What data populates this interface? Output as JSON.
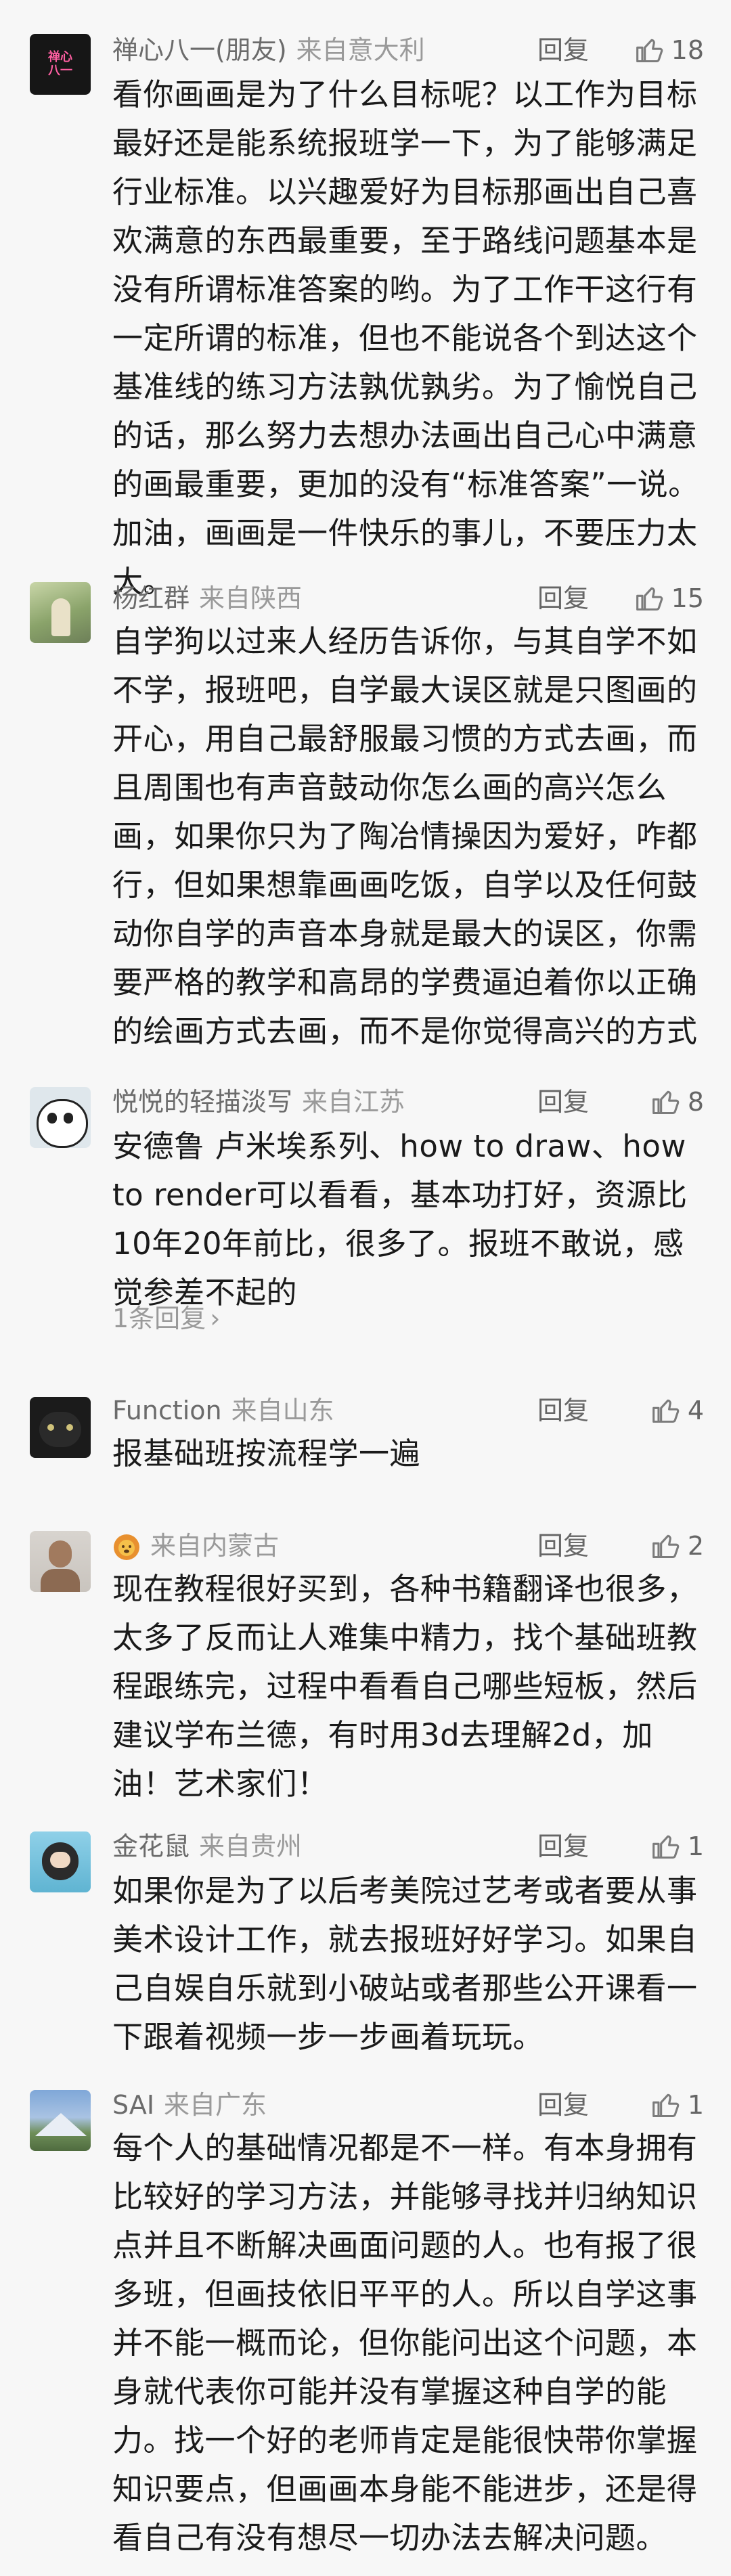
{
  "ui": {
    "reply_label": "回复",
    "thumb_color": "#7c7c7c"
  },
  "comments": [
    {
      "name": "禅心八一(朋友)",
      "location": "来自意大利",
      "likes": "18",
      "avatar_text": "禅心\n八一",
      "text": "看你画画是为了什么目标呢？以工作为目标最好还是能系统报班学一下，为了能够满足行业标准。以兴趣爱好为目标那画出自己喜欢满意的东西最重要，至于路线问题基本是没有所谓标准答案的哟。为了工作干这行有一定所谓的标准，但也不能说各个到达这个基准线的练习方法孰优孰劣。为了愉悦自己的话，那么努力去想办法画出自己心中满意的画最重要，更加的没有“标准答案”一说。加油，画画是一件快乐的事儿，不要压力太大。"
    },
    {
      "name": "杨红群",
      "location": "来自陕西",
      "likes": "15",
      "text": "自学狗以过来人经历告诉你，与其自学不如不学，报班吧，自学最大误区就是只图画的开心，用自己最舒服最习惯的方式去画，而且周围也有声音鼓动你怎么画的高兴怎么画，如果你只为了陶冶情操因为爱好，咋都行，但如果想靠画画吃饭，自学以及任何鼓动你自学的声音本身就是最大的误区，你需要严格的教学和高昂的学费逼迫着你以正确的绘画方式去画，而不是你觉得高兴的方式"
    },
    {
      "name": "悦悦的轻描淡写",
      "location": "来自江苏",
      "likes": "8",
      "text": "安德鲁 卢米埃系列、how to draw、how to render可以看看，基本功打好，资源比10年20年前比，很多了。报班不敢说，感觉参差不起的",
      "replies": "1条回复"
    },
    {
      "name": "Function",
      "location": "来自山东",
      "likes": "4",
      "text": "报基础班按流程学一遍"
    },
    {
      "name": "",
      "location": "来自内蒙古",
      "likes": "2",
      "text": "现在教程很好买到，各种书籍翻译也很多，太多了反而让人难集中精力，找个基础班教程跟练完，过程中看看自己哪些短板，然后建议学布兰德，有时用3d去理解2d，加油！艺术家们！"
    },
    {
      "name": "金花鼠",
      "location": "来自贵州",
      "likes": "1",
      "text": "如果你是为了以后考美院过艺考或者要从事美术设计工作，就去报班好好学习。如果自己自娱自乐就到小破站或者那些公开课看一下跟着视频一步一步画着玩玩。"
    },
    {
      "name": "SAI",
      "location": "来自广东",
      "likes": "1",
      "text": "每个人的基础情况都是不一样。有本身拥有比较好的学习方法，并能够寻找并归纳知识点并且不断解决画面问题的人。也有报了很多班，但画技依旧平平的人。所以自学这事并不能一概而论，但你能问出这个问题，本身就代表你可能并没有掌握这种自学的能力。找一个好的老师肯定是能很快带你掌握知识要点，但画画本身能不能进步，还是得看自己有没有想尽一切办法去解决问题。"
    }
  ]
}
